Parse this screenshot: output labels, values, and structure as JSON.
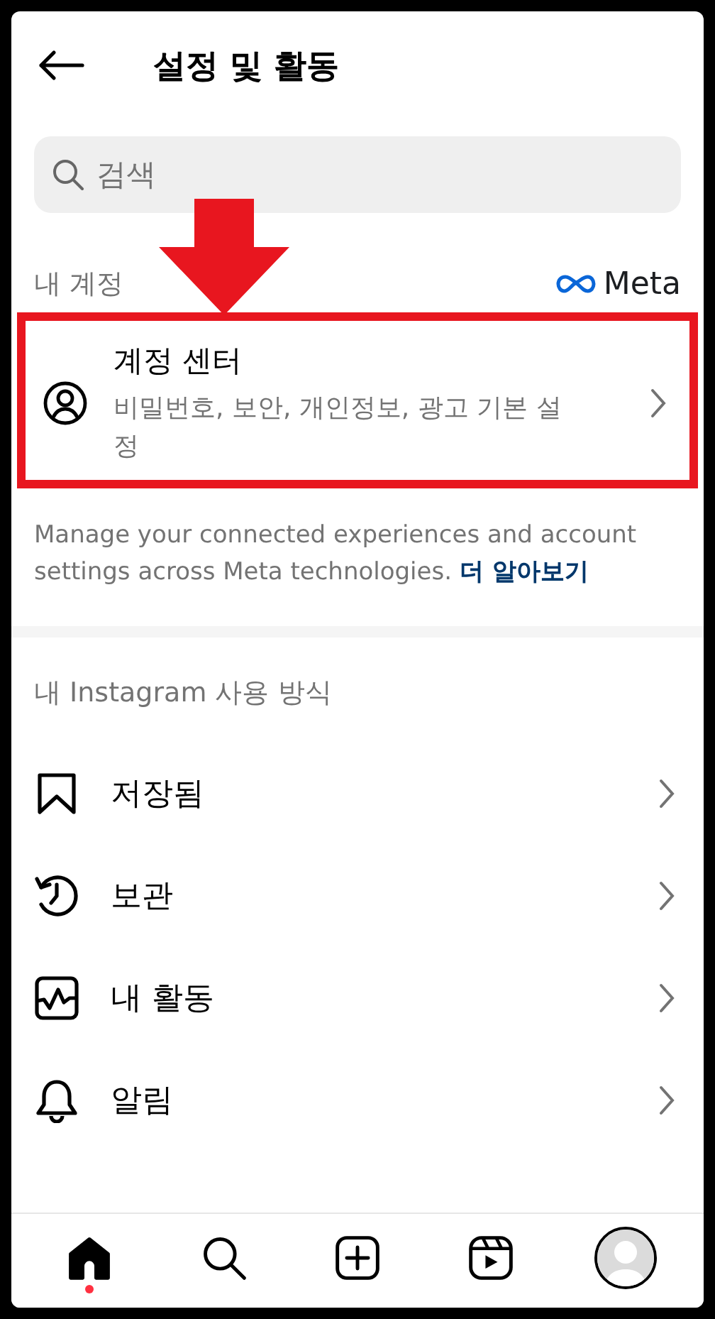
{
  "header": {
    "title": "설정 및 활동"
  },
  "search": {
    "placeholder": "검색"
  },
  "account_section": {
    "label": "내 계정",
    "brand": "Meta"
  },
  "account_center": {
    "title": "계정 센터",
    "subtitle": "비밀번호, 보안, 개인정보, 광고 기본 설정",
    "highlighted": true
  },
  "account_note": {
    "text": "Manage your connected experiences and account settings across Meta technologies.",
    "link": "더 알아보기"
  },
  "usage_section": {
    "label": "내 Instagram 사용 방식"
  },
  "items": [
    {
      "kind": "saved",
      "label": "저장됨"
    },
    {
      "kind": "archive",
      "label": "보관"
    },
    {
      "kind": "activity",
      "label": "내 활동"
    },
    {
      "kind": "notifications",
      "label": "알림"
    }
  ],
  "nav": [
    {
      "kind": "home",
      "selected": true,
      "badge": true
    },
    {
      "kind": "search",
      "selected": false,
      "badge": false
    },
    {
      "kind": "create",
      "selected": false,
      "badge": false
    },
    {
      "kind": "reels",
      "selected": false,
      "badge": false
    },
    {
      "kind": "profile",
      "selected": false,
      "badge": false
    }
  ]
}
